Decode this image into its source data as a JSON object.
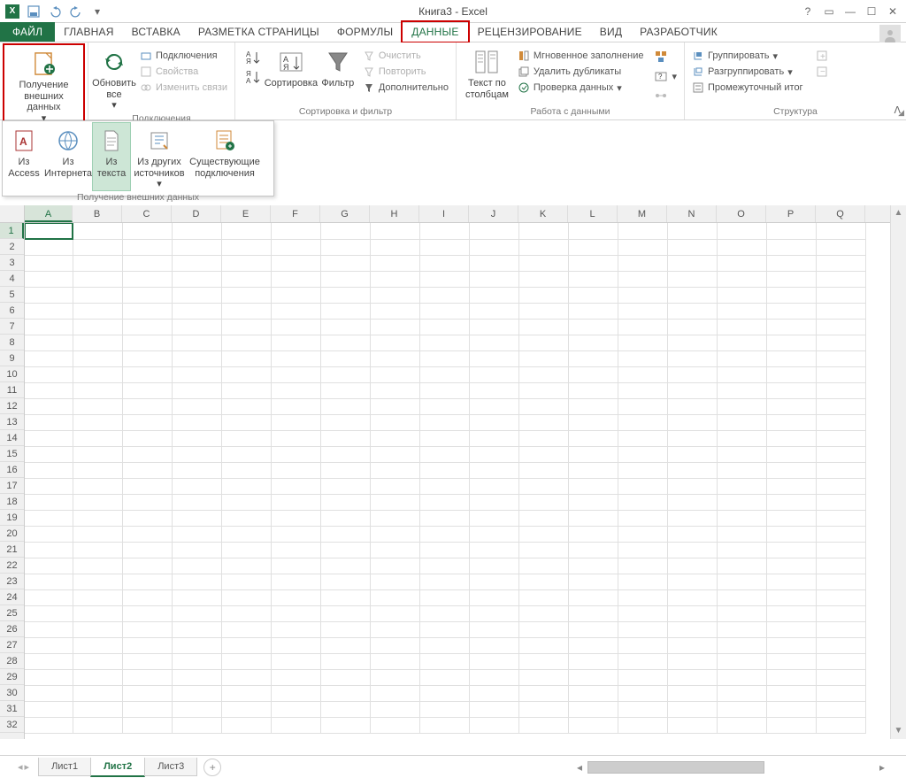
{
  "window": {
    "title": "Книга3 - Excel"
  },
  "tabs": {
    "file": "ФАЙЛ",
    "items": [
      "ГЛАВНАЯ",
      "ВСТАВКА",
      "РАЗМЕТКА СТРАНИЦЫ",
      "ФОРМУЛЫ",
      "ДАННЫЕ",
      "РЕЦЕНЗИРОВАНИЕ",
      "ВИД",
      "РАЗРАБОТЧИК"
    ],
    "active": "ДАННЫЕ",
    "highlighted": "ДАННЫЕ"
  },
  "ribbon": {
    "get_external": {
      "btn": "Получение внешних данных",
      "dropdown_label": "Получение внешних данных",
      "items": {
        "access": "Из Access",
        "web": "Из Интернета",
        "text": "Из текста",
        "other": "Из других источников",
        "existing": "Существующие подключения"
      }
    },
    "connections": {
      "refresh": "Обновить все",
      "connections": "Подключения",
      "properties": "Свойства",
      "edit_links": "Изменить связи",
      "label": "Подключения"
    },
    "sort_filter": {
      "sort": "Сортировка",
      "filter": "Фильтр",
      "clear": "Очистить",
      "reapply": "Повторить",
      "advanced": "Дополнительно",
      "label": "Сортировка и фильтр"
    },
    "data_tools": {
      "text_to_columns": "Текст по столбцам",
      "flash_fill": "Мгновенное заполнение",
      "remove_dup": "Удалить дубликаты",
      "validation": "Проверка данных",
      "label": "Работа с данными"
    },
    "data_tools2": {
      "consolidate_icon": "consolidate",
      "whatif_icon": "what-if",
      "relationships_icon": "relationships"
    },
    "outline": {
      "group": "Группировать",
      "ungroup": "Разгруппировать",
      "subtotal": "Промежуточный итог",
      "label": "Структура"
    }
  },
  "grid": {
    "columns": [
      "A",
      "B",
      "C",
      "D",
      "E",
      "F",
      "G",
      "H",
      "I",
      "J",
      "K",
      "L",
      "M",
      "N",
      "O",
      "P",
      "Q"
    ],
    "num_rows": 32,
    "selected_cell": "A1",
    "selected_col_index": 0,
    "selected_row_index": 0,
    "col_width_first": 54,
    "col_width_rest": 56,
    "last_col_letter_partial": "Q"
  },
  "sheets": {
    "items": [
      "Лист1",
      "Лист2",
      "Лист3"
    ],
    "active": "Лист2"
  }
}
